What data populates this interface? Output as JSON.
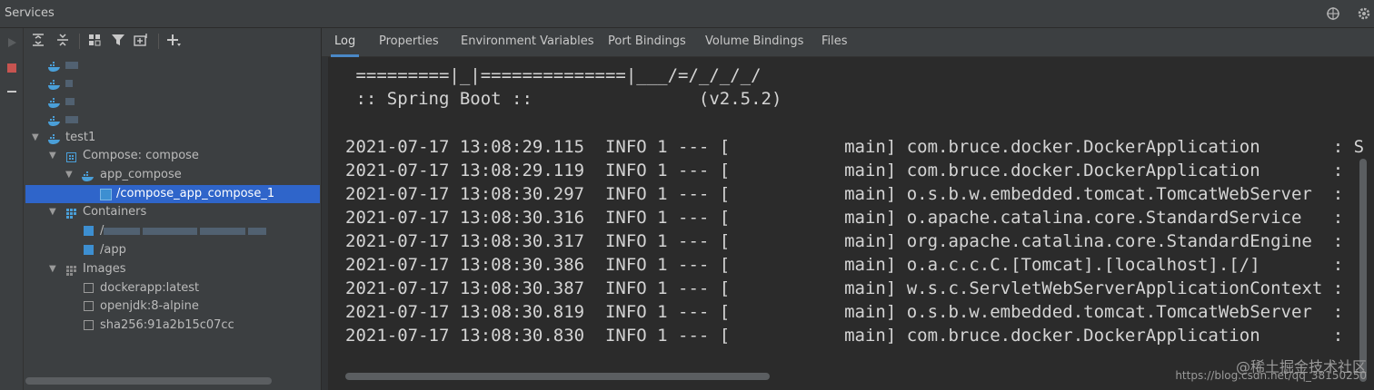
{
  "title_bar": {
    "title": "Services",
    "target_icon": "crosshair-icon",
    "settings_icon": "gear-icon"
  },
  "left_strip": {
    "run_icon": "play-icon",
    "stop_icon": "stop-icon",
    "collapse_icon": "minus-icon",
    "stop_color": "#c75450"
  },
  "toolbar": {
    "icons": [
      "expand-all-icon",
      "collapse-all-icon",
      "group-by-icon",
      "filter-icon",
      "new-service-icon",
      "add-icon"
    ]
  },
  "tree": {
    "blurred_services_count": 4,
    "items": [
      {
        "label": "test1",
        "icon": "docker-icon",
        "expanded": true
      },
      {
        "label": "Compose: compose",
        "icon": "compose-icon",
        "expanded": true
      },
      {
        "label": "app_compose",
        "icon": "docker-icon",
        "expanded": true
      },
      {
        "label": "/compose_app_compose_1",
        "icon": "container-icon",
        "selected": true
      },
      {
        "label": "Containers",
        "icon": "containers-icon",
        "expanded": true
      },
      {
        "label": "/",
        "icon": "container-icon",
        "blurred": true
      },
      {
        "label": "/app",
        "icon": "container-icon"
      },
      {
        "label": "Images",
        "icon": "images-icon",
        "expanded": true
      },
      {
        "label": "dockerapp:latest",
        "icon": "image-icon"
      },
      {
        "label": "openjdk:8-alpine",
        "icon": "image-icon"
      },
      {
        "label": "sha256:91a2b15c07cc",
        "icon": "image-icon"
      }
    ]
  },
  "tabs": [
    "Log",
    "Properties",
    "Environment Variables",
    "Port Bindings",
    "Volume Bindings",
    "Files"
  ],
  "active_tab": "Log",
  "log": {
    "banner": [
      " =========|_|==============|___/=/_/_/_/",
      " :: Spring Boot ::                (v2.5.2)"
    ],
    "lines": [
      "2021-07-17 13:08:29.115  INFO 1 --- [           main] com.bruce.docker.DockerApplication       : S",
      "2021-07-17 13:08:29.119  INFO 1 --- [           main] com.bruce.docker.DockerApplication       :",
      "2021-07-17 13:08:30.297  INFO 1 --- [           main] o.s.b.w.embedded.tomcat.TomcatWebServer  :",
      "2021-07-17 13:08:30.316  INFO 1 --- [           main] o.apache.catalina.core.StandardService   :",
      "2021-07-17 13:08:30.317  INFO 1 --- [           main] org.apache.catalina.core.StandardEngine  :",
      "2021-07-17 13:08:30.386  INFO 1 --- [           main] o.a.c.c.C.[Tomcat].[localhost].[/]       :",
      "2021-07-17 13:08:30.387  INFO 1 --- [           main] w.s.c.ServletWebServerApplicationContext :",
      "2021-07-17 13:08:30.819  INFO 1 --- [           main] o.s.b.w.embedded.tomcat.TomcatWebServer  :",
      "2021-07-17 13:08:30.830  INFO 1 --- [           main] com.bruce.docker.DockerApplication       :"
    ]
  },
  "watermark": {
    "text": "@稀土掘金技术社区",
    "url": "https://blog.csdn.net/qq_38150250"
  },
  "colors": {
    "selection": "#2f65ca",
    "tab_underline": "#4a88c7",
    "docker_blue": "#4a9fd8",
    "container_blue": "#3d8fd1"
  }
}
